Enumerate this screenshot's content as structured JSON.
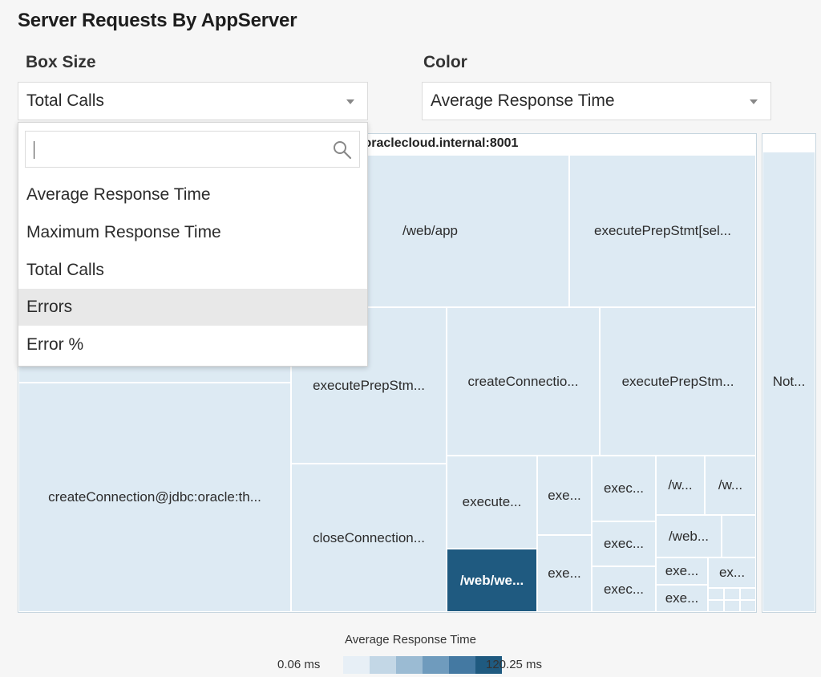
{
  "title": "Server Requests By AppServer",
  "box_size": {
    "label": "Box Size",
    "value": "Total Calls"
  },
  "color": {
    "label": "Color",
    "value": "Average Response Time"
  },
  "dropdown": {
    "search_placeholder": "",
    "options": [
      "Average Response Time",
      "Maximum Response Time",
      "Total Calls",
      "Errors",
      "Error %"
    ],
    "hovered": "Errors"
  },
  "treemap": {
    "group_header": ".oraclecloud.internal:8001",
    "cells": [
      {
        "label": "/web/app"
      },
      {
        "label": "executePrepStmt[sel..."
      },
      {
        "label": "executePrepStm..."
      },
      {
        "label": "createConnectio..."
      },
      {
        "label": "executePrepStm..."
      },
      {
        "label": "Not..."
      },
      {
        "label": "createConnection@jdbc:oracle:th..."
      },
      {
        "label": "closeConnection..."
      },
      {
        "label": "execute..."
      },
      {
        "label": "exe..."
      },
      {
        "label": "exec..."
      },
      {
        "label": "/w..."
      },
      {
        "label": "/w..."
      },
      {
        "label": "exec..."
      },
      {
        "label": "/web..."
      },
      {
        "label": "/web/we..."
      },
      {
        "label": "exe..."
      },
      {
        "label": "exec..."
      },
      {
        "label": "exe..."
      },
      {
        "label": "ex..."
      },
      {
        "label": "exe..."
      }
    ]
  },
  "legend": {
    "title": "Average Response Time",
    "min": "0.06 ms",
    "max": "120.25 ms",
    "colors": [
      "#e7eff6",
      "#c3d7e6",
      "#9bbbd3",
      "#6f9bbd",
      "#4479a2",
      "#1f5a80"
    ]
  }
}
